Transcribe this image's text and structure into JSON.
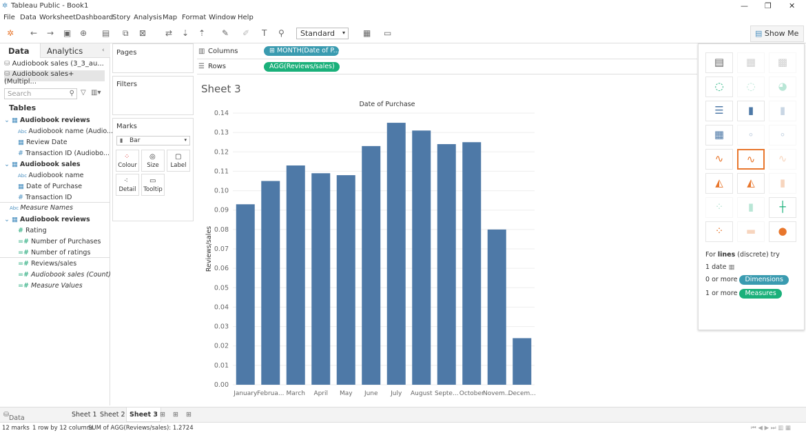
{
  "window": {
    "title": "Tableau Public - Book1"
  },
  "menu": [
    "File",
    "Data",
    "Worksheet",
    "Dashboard",
    "Story",
    "Analysis",
    "Map",
    "Format",
    "Window",
    "Help"
  ],
  "toolbar": {
    "fit": "Standard",
    "show_me": "Show Me"
  },
  "left": {
    "tabs": [
      "Data",
      "Analytics"
    ],
    "sources": [
      "Audiobook sales (3_3_au...",
      "Audiobook sales+ (Multipl..."
    ],
    "search_placeholder": "Search",
    "tables_header": "Tables",
    "fields": [
      {
        "label": "Audiobook reviews",
        "kind": "table"
      },
      {
        "label": "Audiobook name (Audio...",
        "kind": "dim"
      },
      {
        "label": "Review Date",
        "kind": "dim"
      },
      {
        "label": "Transaction ID (Audiobo...",
        "kind": "dim"
      },
      {
        "label": "Audiobook sales",
        "kind": "table"
      },
      {
        "label": "Audiobook name",
        "kind": "dim"
      },
      {
        "label": "Date of Purchase",
        "kind": "dim"
      },
      {
        "label": "Transaction ID",
        "kind": "dim"
      },
      {
        "label": "Measure Names",
        "kind": "dim-italic"
      },
      {
        "label": "Audiobook reviews",
        "kind": "table"
      },
      {
        "label": "Rating",
        "kind": "meas"
      },
      {
        "label": "Number of Purchases",
        "kind": "meas"
      },
      {
        "label": "Number of ratings",
        "kind": "meas"
      },
      {
        "label": "Reviews/sales",
        "kind": "meas"
      },
      {
        "label": "Audiobook sales (Count)",
        "kind": "meas-italic"
      },
      {
        "label": "Measure Values",
        "kind": "meas-italic"
      }
    ]
  },
  "cards": {
    "pages": "Pages",
    "filters": "Filters",
    "marks": "Marks",
    "mark_type": "Bar",
    "mark_buttons": [
      "Colour",
      "Size",
      "Label",
      "Detail",
      "Tooltip"
    ]
  },
  "shelves": {
    "columns_label": "Columns",
    "columns_pill": "MONTH(Date of P...",
    "rows_label": "Rows",
    "rows_pill": "AGG(Reviews/sales)"
  },
  "sheet_title": "Sheet 3",
  "chart_data": {
    "type": "bar",
    "title": "Date of Purchase",
    "xlabel": "",
    "ylabel": "Reviews/sales",
    "categories": [
      "January",
      "Februa...",
      "March",
      "April",
      "May",
      "June",
      "July",
      "August",
      "Septe...",
      "October",
      "Novem...",
      "Decem..."
    ],
    "values": [
      0.093,
      0.105,
      0.113,
      0.109,
      0.108,
      0.123,
      0.135,
      0.131,
      0.124,
      0.125,
      0.08,
      0.024
    ],
    "ylim": [
      0,
      0.14
    ],
    "yticks": [
      "0.00",
      "0.01",
      "0.02",
      "0.03",
      "0.04",
      "0.05",
      "0.06",
      "0.07",
      "0.08",
      "0.09",
      "0.10",
      "0.11",
      "0.12",
      "0.13",
      "0.14"
    ],
    "grid": true,
    "bar_color": "#4e79a7"
  },
  "show_me": {
    "hint_prefix": "For",
    "hint_bold": "lines",
    "hint_suffix": "(discrete) try",
    "req1": "1 date",
    "req2": "0 or more",
    "req2_pill": "Dimensions",
    "req3": "1 or more",
    "req3_pill": "Measures"
  },
  "bottom_tabs": [
    "Data Source",
    "Sheet 1",
    "Sheet 2",
    "Sheet 3"
  ],
  "status": {
    "marks": "12 marks",
    "dims": "1 row by 12 columns",
    "sum": "SUM of AGG(Reviews/sales): 1.2724"
  },
  "colors": {
    "pill_dim": "#3a9bb0",
    "pill_meas": "#1ab07a",
    "accent": "#e8762c"
  }
}
